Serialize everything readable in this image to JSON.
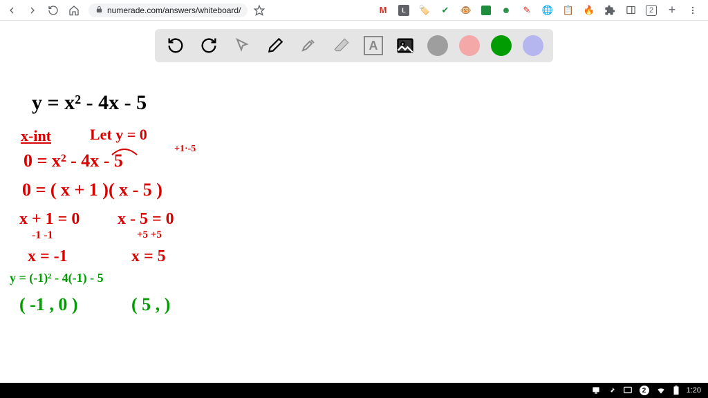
{
  "browser": {
    "url": "numerade.com/answers/whiteboard/",
    "tab_badge": "2"
  },
  "whiteboard": {
    "lines": {
      "eq": "y = x² - 4x - 5",
      "xint": "x-int",
      "lety": "Let y = 0",
      "hint": "+1·-5",
      "l1": "0 = x² - 4x - 5",
      "l2": "0 = ( x + 1 )( x - 5 )",
      "l3a": "x + 1 = 0",
      "l3b": "x - 5 = 0",
      "l4a": "-1  -1",
      "l4b": "+5  +5",
      "l5a": "x = -1",
      "l5b": "x = 5",
      "check": "y = (-1)² - 4(-1) - 5",
      "p1": "( -1 , 0 )",
      "p2": "( 5 ,      )"
    }
  },
  "toolbar": {
    "colors": {
      "gray": "#9e9e9e",
      "pink": "#f4a8a8",
      "green": "#019c01",
      "lav": "#b5b5f0"
    }
  },
  "taskbar": {
    "time": "1:20",
    "noti": "2"
  }
}
